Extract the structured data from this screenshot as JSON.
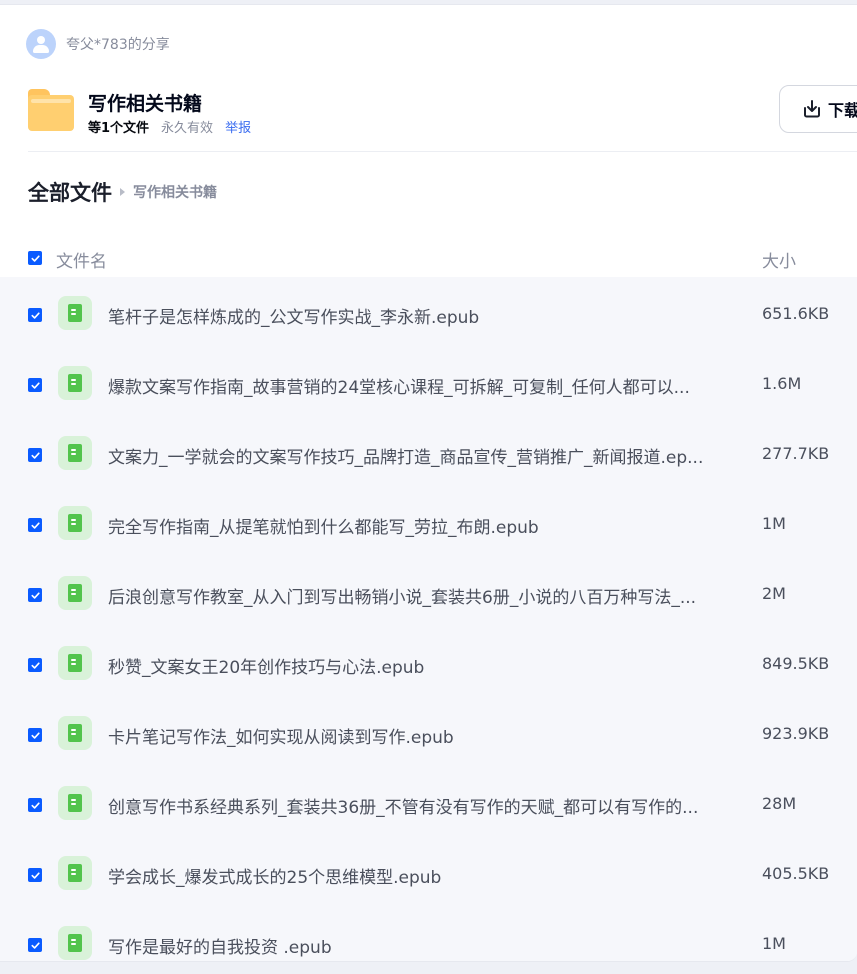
{
  "sharer": {
    "name": "夸父*783的分享"
  },
  "share": {
    "title": "写作相关书籍",
    "file_count": "等1个文件",
    "validity": "永久有效",
    "report_label": "举报",
    "download_label": "下载"
  },
  "breadcrumb": {
    "root": "全部文件",
    "current": "写作相关书籍"
  },
  "table": {
    "col_name": "文件名",
    "col_size": "大小",
    "rows": [
      {
        "name": "笔杆子是怎样炼成的_公文写作实战_李永新.epub",
        "size": "651.6KB"
      },
      {
        "name": "爆款文案写作指南_故事营销的24堂核心课程_可拆解_可复制_任何人都可以...",
        "size": "1.6M"
      },
      {
        "name": "文案力_一学就会的文案写作技巧_品牌打造_商品宣传_营销推广_新闻报道.ep...",
        "size": "277.7KB"
      },
      {
        "name": "完全写作指南_从提笔就怕到什么都能写_劳拉_布朗.epub",
        "size": "1M"
      },
      {
        "name": "后浪创意写作教室_从入门到写出畅销小说_套装共6册_小说的八百万种写法_...",
        "size": "2M"
      },
      {
        "name": "秒赞_文案女王20年创作技巧与心法.epub",
        "size": "849.5KB"
      },
      {
        "name": "卡片笔记写作法_如何实现从阅读到写作.epub",
        "size": "923.9KB"
      },
      {
        "name": "创意写作书系经典系列_套装共36册_不管有没有写作的天赋_都可以有写作的...",
        "size": "28M"
      },
      {
        "name": "学会成长_爆发式成长的25个思维模型.epub",
        "size": "405.5KB"
      },
      {
        "name": "写作是最好的自我投资 .epub",
        "size": "1M"
      }
    ]
  },
  "colors": {
    "accent": "#0a5bff",
    "link": "#3a6cf0",
    "folder": "#ffcf70",
    "epub_icon": "#52c44c"
  },
  "icons": {
    "avatar": "user-avatar-icon",
    "folder": "folder-icon",
    "download": "download-icon",
    "epub": "epub-file-icon",
    "check": "checkmark-icon"
  }
}
